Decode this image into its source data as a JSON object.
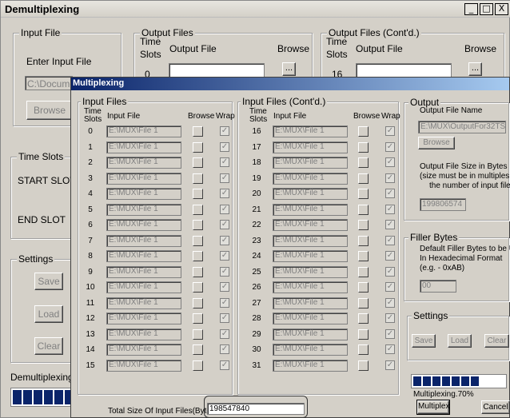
{
  "main": {
    "title": "Demultiplexing",
    "controls": {
      "minimize": "_",
      "maximize": "□",
      "close": "X"
    },
    "input_file": {
      "group": "Input File",
      "label": "Enter Input File",
      "value": "C:\\Docume",
      "browse": "Browse"
    },
    "output_files": {
      "group": "Output Files",
      "time_slots_line1": "Time",
      "time_slots_line2": "Slots",
      "col_file": "Output File",
      "col_browse": "Browse",
      "slot": "0",
      "browse_btn": "..."
    },
    "output_files_contd": {
      "group": "Output Files (Cont'd.)",
      "time_slots_line1": "Time",
      "time_slots_line2": "Slots",
      "col_file": "Output File",
      "col_browse": "Browse",
      "slot": "16",
      "browse_btn": "..."
    },
    "time_slots": {
      "group": "Time Slots",
      "start": "START SLOT",
      "end": "END SLOT"
    },
    "settings": {
      "group": "Settings",
      "save": "Save",
      "load": "Load",
      "clear": "Clear"
    },
    "status": "Demultiplexing...",
    "progress_fraction": 0.31
  },
  "dialog": {
    "title": "Multiplexing",
    "input_files": {
      "group": "Input Files",
      "col_time": "Time",
      "col_slots": "Slots",
      "col_file": "Input File",
      "col_browse": "Browse",
      "col_wrap": "Wrap",
      "rows": [
        {
          "slot": "0",
          "file": "E:\\MUX\\File 1"
        },
        {
          "slot": "1",
          "file": "E:\\MUX\\File 1"
        },
        {
          "slot": "2",
          "file": "E:\\MUX\\File 1"
        },
        {
          "slot": "3",
          "file": "E:\\MUX\\File 1"
        },
        {
          "slot": "4",
          "file": "E:\\MUX\\File 1"
        },
        {
          "slot": "5",
          "file": "E:\\MUX\\File 1"
        },
        {
          "slot": "6",
          "file": "E:\\MUX\\File 1"
        },
        {
          "slot": "7",
          "file": "E:\\MUX\\File 1"
        },
        {
          "slot": "8",
          "file": "E:\\MUX\\File 1"
        },
        {
          "slot": "9",
          "file": "E:\\MUX\\File 1"
        },
        {
          "slot": "10",
          "file": "E:\\MUX\\File 1"
        },
        {
          "slot": "11",
          "file": "E:\\MUX\\File 1"
        },
        {
          "slot": "12",
          "file": "E:\\MUX\\File 1"
        },
        {
          "slot": "13",
          "file": "E:\\MUX\\File 1"
        },
        {
          "slot": "14",
          "file": "E:\\MUX\\File 1"
        },
        {
          "slot": "15",
          "file": "E:\\MUX\\File 1"
        }
      ]
    },
    "input_files_contd": {
      "group": "Input Files (Cont'd.)",
      "col_time": "Time",
      "col_slots": "Slots",
      "col_file": "Input File",
      "col_browse": "Browse",
      "col_wrap": "Wrap",
      "rows": [
        {
          "slot": "16",
          "file": "E:\\MUX\\File 1"
        },
        {
          "slot": "17",
          "file": "E:\\MUX\\File 1"
        },
        {
          "slot": "18",
          "file": "E:\\MUX\\File 1"
        },
        {
          "slot": "19",
          "file": "E:\\MUX\\File 1"
        },
        {
          "slot": "20",
          "file": "E:\\MUX\\File 1"
        },
        {
          "slot": "21",
          "file": "E:\\MUX\\File 1"
        },
        {
          "slot": "22",
          "file": "E:\\MUX\\File 1"
        },
        {
          "slot": "23",
          "file": "E:\\MUX\\File 1"
        },
        {
          "slot": "24",
          "file": "E:\\MUX\\File 1"
        },
        {
          "slot": "25",
          "file": "E:\\MUX\\File 1"
        },
        {
          "slot": "26",
          "file": "E:\\MUX\\File 1"
        },
        {
          "slot": "27",
          "file": "E:\\MUX\\File 1"
        },
        {
          "slot": "28",
          "file": "E:\\MUX\\File 1"
        },
        {
          "slot": "29",
          "file": "E:\\MUX\\File 1"
        },
        {
          "slot": "30",
          "file": "E:\\MUX\\File 1"
        },
        {
          "slot": "31",
          "file": "E:\\MUX\\File 1"
        }
      ]
    },
    "wrap_mark": "✓",
    "output": {
      "group": "Output",
      "file_name_label": "Output File Name",
      "file_name": "E:\\MUX\\OutputFor32TS",
      "browse": "Browse",
      "size_line1": "Output File Size in Bytes",
      "size_line2": "(size must be in multiples of",
      "size_line3": "the number of input files)",
      "size_value": "199806574"
    },
    "filler": {
      "group": "Filler Bytes",
      "line1": "Default Filler Bytes to be Used",
      "line2": "In Hexadecimal Format",
      "line3": "(e.g. - 0xAB)",
      "value": "00"
    },
    "settings": {
      "group": "Settings",
      "save": "Save",
      "load": "Load",
      "clear": "Clear"
    },
    "progress_fraction": 0.76,
    "status": "Multiplexing.70%",
    "multiplex_button": "Multiplex",
    "cancel_button": "Cancel",
    "total_label": "Total Size Of Input Files(Bytes)",
    "total_value": "198547840"
  }
}
